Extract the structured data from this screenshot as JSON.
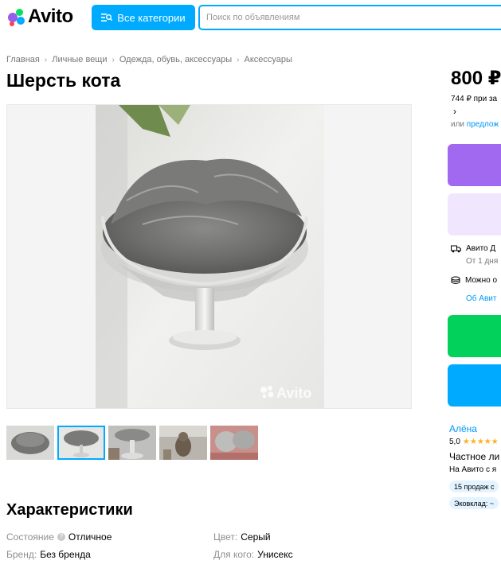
{
  "header": {
    "logo_text": "Avito",
    "categories_button": "Все категории",
    "search_placeholder": "Поиск по объявлениям"
  },
  "breadcrumbs": [
    "Главная",
    "Личные вещи",
    "Одежда, обувь, аксессуары",
    "Аксессуары"
  ],
  "listing": {
    "title": "Шерсть кота",
    "image_watermark": "Avito",
    "thumbnail_count": 5,
    "active_thumbnail": 2
  },
  "characteristics": {
    "heading": "Характеристики",
    "items": [
      {
        "key": "Состояние",
        "value": "Отличное"
      },
      {
        "key": "Цвет:",
        "value": "Серый"
      },
      {
        "key": "Бренд:",
        "value": "Без бренда"
      },
      {
        "key": "Для кого:",
        "value": "Унисекс"
      }
    ]
  },
  "sidebar": {
    "price": "800 ₽",
    "sub_price": "744 ₽ при за",
    "or_text": "или",
    "or_link": "предлож",
    "delivery_label": "Авито Д",
    "delivery_sub": "От 1 дня",
    "payment_label": "Можно о",
    "about_link": "Об Авит",
    "seller_name": "Алёна",
    "rating": "5,0",
    "stars": "★★★★★",
    "seller_type": "Частное ли",
    "seller_since": "На Авито с я",
    "badge_sales": "15 продаж с",
    "badge_eco": "Эковклад: ~"
  },
  "colors": {
    "accent_blue": "#00aaff",
    "purple_button": "#a168f0",
    "light_purple_button": "#f0e7ff",
    "green_button": "#02d15c",
    "blue_button": "#00aaff",
    "link_blue": "#0099f7",
    "star": "#ffb021"
  }
}
